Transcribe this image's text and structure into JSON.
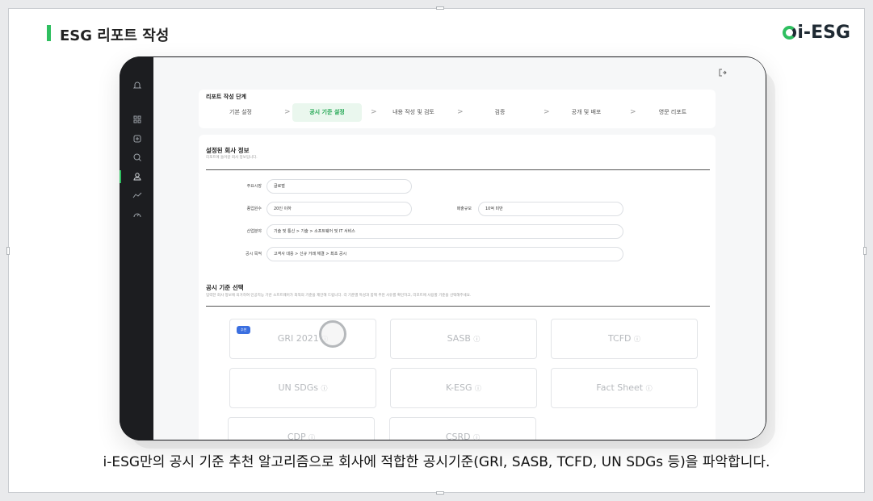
{
  "header": {
    "title": "ESG 리포트 작성",
    "logo": "i-ESG"
  },
  "caption": "i-ESG만의 공시 기준 추천 알고리즘으로 회사에 적합한 공시기준(GRI, SASB, TCFD, UN SDGs 등)을 파악합니다.",
  "colors": {
    "accent": "#2fbf60",
    "badge": "#3b6fe0",
    "device": "#1c1d20"
  },
  "sidebar": {
    "icons": [
      "bell-icon",
      "grid-icon",
      "plus-square-icon",
      "search-zoom-icon",
      "user-icon",
      "trend-icon",
      "gauge-icon"
    ]
  },
  "steps": {
    "title": "리포트 작성 단계",
    "items": [
      {
        "label": "기본 설정"
      },
      {
        "label": "공시 기준 설정"
      },
      {
        "label": "내용 작성 및 검토"
      },
      {
        "label": "검증"
      },
      {
        "label": "공개 및 배포"
      },
      {
        "label": "영문 리포트"
      }
    ],
    "separator": ">"
  },
  "company": {
    "title": "설정된 회사 정보",
    "desc": "리포트에 들어갈 회사 정보입니다.",
    "fields": {
      "market_label": "주요시장",
      "market_value": "글로벌",
      "employees_label": "종업원수",
      "employees_value": "20인 이하",
      "revenue_label": "매출규모",
      "revenue_value": "10억 미만",
      "industry_label": "산업분야",
      "industry_value": "기술 및 통신 > 기술 > 소프트웨어 및 IT 서비스",
      "purpose_label": "공시 목적",
      "purpose_value": "고객사 대응 > 신규 거래 체결 > 최초 공시"
    }
  },
  "standards": {
    "title": "공시 기준 선택",
    "desc": "입력한 회사 정보에 의거하여 인공지능 기반 소프트웨어가 최적의 기준을 제안해 드립니다. 각 기준별 특성과 함께 추천 사유를 확인하고, 리포트에 사용할 기준을 선택해주세요.",
    "recommended_badge": "추천",
    "info_glyph": "ⓘ",
    "cards": [
      "GRI 2021",
      "SASB",
      "TCFD",
      "UN SDGs",
      "K-ESG",
      "Fact Sheet",
      "CDP",
      "CSRD"
    ]
  }
}
